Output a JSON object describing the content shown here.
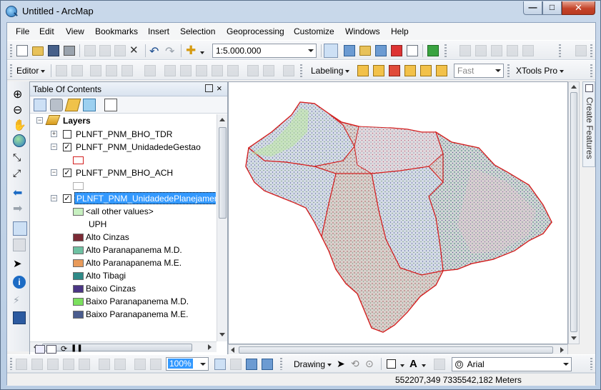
{
  "window": {
    "title": "Untitled - ArcMap",
    "min_label": "—",
    "max_label": "□",
    "close_label": "✕"
  },
  "menu": {
    "file": "File",
    "edit": "Edit",
    "view": "View",
    "bookmarks": "Bookmarks",
    "insert": "Insert",
    "selection": "Selection",
    "geoprocessing": "Geoprocessing",
    "customize": "Customize",
    "windows": "Windows",
    "help": "Help"
  },
  "standard_toolbar": {
    "scale_value": "1:5.000.000"
  },
  "editor_toolbar": {
    "editor_label": "Editor",
    "labeling_label": "Labeling",
    "fast_value": "Fast",
    "xtools_label": "XTools Pro"
  },
  "toc": {
    "title": "Table Of Contents",
    "close_label": "×",
    "layers_root": "Layers",
    "layers": [
      {
        "name": "PLNFT_PNM_BHO_TDR",
        "checked": false,
        "expanded": false
      },
      {
        "name": "PLNFT_PNM_UnidadedeGestao",
        "checked": true,
        "expanded": true
      },
      {
        "name": "PLNFT_PNM_BHO_ACH",
        "checked": true,
        "expanded": true
      },
      {
        "name": "PLNFT_PNM_UnidadedePlanejamen",
        "checked": true,
        "expanded": true,
        "selected": true
      }
    ],
    "other_values_label": "<all other values>",
    "field_heading": "UPH",
    "legend": [
      {
        "label": "Alto Cinzas",
        "color": "#7b2a35"
      },
      {
        "label": "Alto Paranapanema M.D.",
        "color": "#6ec1a2"
      },
      {
        "label": "Alto Paranapanema M.E.",
        "color": "#e89a5a"
      },
      {
        "label": "Alto Tibagi",
        "color": "#2f8a88"
      },
      {
        "label": "Baixo Cinzas",
        "color": "#4b3585"
      },
      {
        "label": "Baixo Paranapanema M.D.",
        "color": "#7be05e"
      },
      {
        "label": "Baixo Paranapanema M.E.",
        "color": "#4a5c8e"
      }
    ],
    "other_values_color": "#c7f0c0",
    "gestao_symbol_color": "#d42020",
    "ach_symbol_color": "#ffffff"
  },
  "right_dock": {
    "create_features_label": "Create Features"
  },
  "bottom_toolbar": {
    "zoom_value": "100%",
    "drawing_label": "Drawing",
    "font_value": "Arial",
    "font_label": "A"
  },
  "status": {
    "coords": "552207,349  7335542,182 Meters"
  }
}
